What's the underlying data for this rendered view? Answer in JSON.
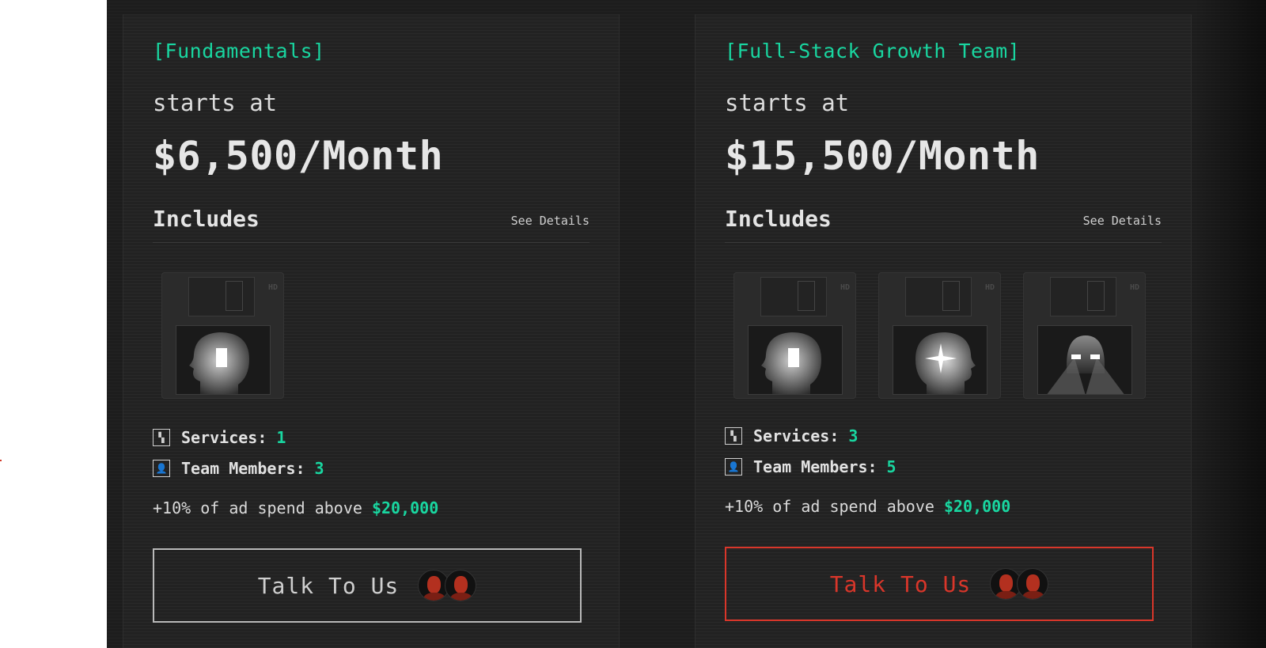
{
  "accent_color": "#19d6a0",
  "cta_highlight_color": "#d9362a",
  "plans": [
    {
      "tag": "[Fundamentals]",
      "starts_label": "starts at",
      "price": "$6,500/Month",
      "includes_label": "Includes",
      "details_link": "See Details",
      "disks": [
        "head-door-icon"
      ],
      "services_label": "Services:",
      "services_value": "1",
      "team_label": "Team Members:",
      "team_value": "3",
      "ad_spend_text": "+10% of ad spend above",
      "ad_spend_amount": "$20,000",
      "cta_label": "Talk To Us"
    },
    {
      "tag": "[Full-Stack Growth Team]",
      "starts_label": "starts at",
      "price": "$15,500/Month",
      "includes_label": "Includes",
      "details_link": "See Details",
      "disks": [
        "head-door-icon",
        "head-star-icon",
        "head-headlights-icon"
      ],
      "services_label": "Services:",
      "services_value": "3",
      "team_label": "Team Members:",
      "team_value": "5",
      "ad_spend_text": "+10% of ad spend above",
      "ad_spend_amount": "$20,000",
      "cta_label": "Talk To Us"
    }
  ]
}
